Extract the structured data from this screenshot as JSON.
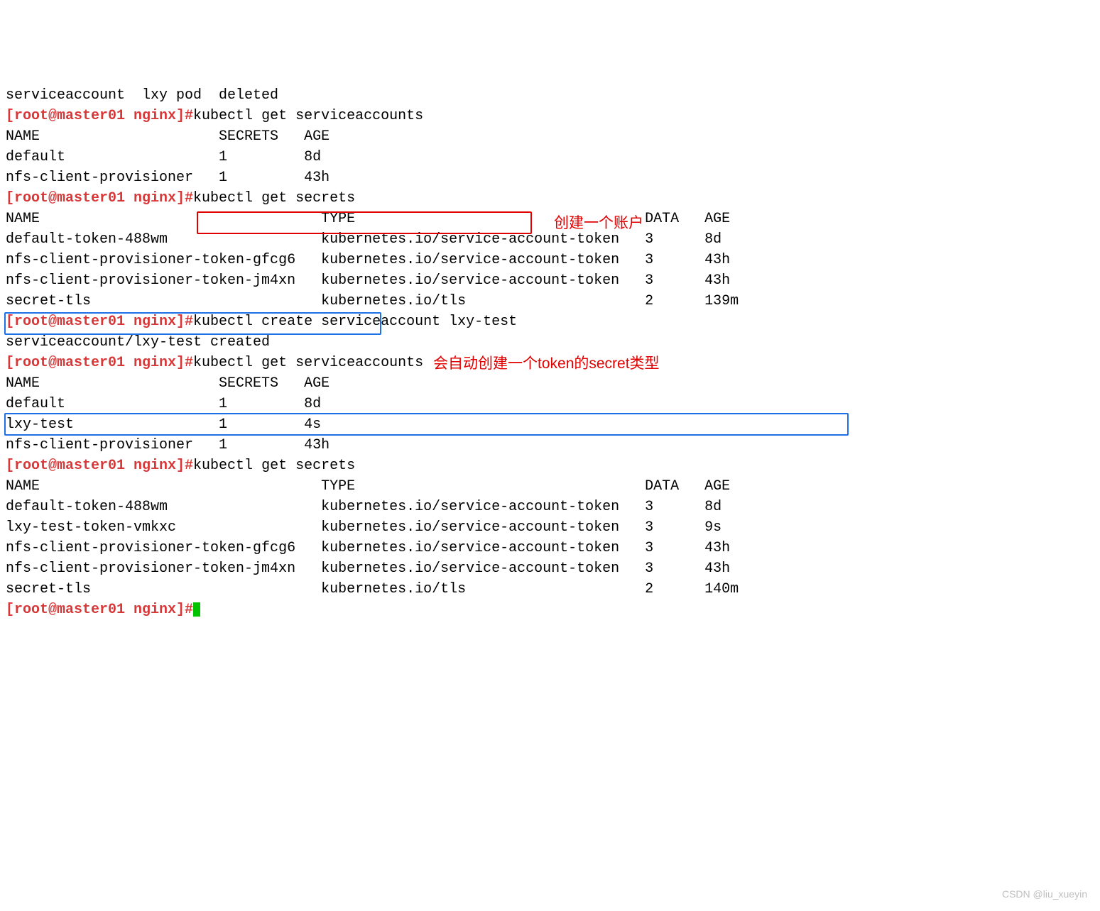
{
  "prompt": "[root@master01 nginx]#",
  "lines": {
    "l0": "serviceaccount  lxy pod  deleted",
    "l1_cmd": "kubectl get serviceaccounts",
    "l2": "NAME                     SECRETS   AGE",
    "l3": "default                  1         8d",
    "l4": "nfs-client-provisioner   1         43h",
    "l5_cmd": "kubectl get secrets",
    "l6": "NAME                                 TYPE                                  DATA   AGE",
    "l7": "default-token-488wm                  kubernetes.io/service-account-token   3      8d",
    "l8": "nfs-client-provisioner-token-gfcg6   kubernetes.io/service-account-token   3      43h",
    "l9": "nfs-client-provisioner-token-jm4xn   kubernetes.io/service-account-token   3      43h",
    "l10": "secret-tls                           kubernetes.io/tls                     2      139m",
    "l11_cmd": "kubectl create serviceaccount lxy-test",
    "l12": "serviceaccount/lxy-test created",
    "l13_cmd": "kubectl get serviceaccounts",
    "l14": "NAME                     SECRETS   AGE",
    "l15": "default                  1         8d",
    "l16": "lxy-test                 1         4s",
    "l17": "nfs-client-provisioner   1         43h",
    "l18_cmd": "kubectl get secrets",
    "l19": "NAME                                 TYPE                                  DATA   AGE",
    "l20": "default-token-488wm                  kubernetes.io/service-account-token   3      8d",
    "l21": "lxy-test-token-vmkxc                 kubernetes.io/service-account-token   3      9s",
    "l22": "nfs-client-provisioner-token-gfcg6   kubernetes.io/service-account-token   3      43h",
    "l23": "nfs-client-provisioner-token-jm4xn   kubernetes.io/service-account-token   3      43h",
    "l24": "secret-tls                           kubernetes.io/tls                     2      140m"
  },
  "annotations": {
    "a1": "创建一个账户",
    "a2": "会自动创建一个token的secret类型"
  },
  "watermark": "CSDN @liu_xueyin"
}
